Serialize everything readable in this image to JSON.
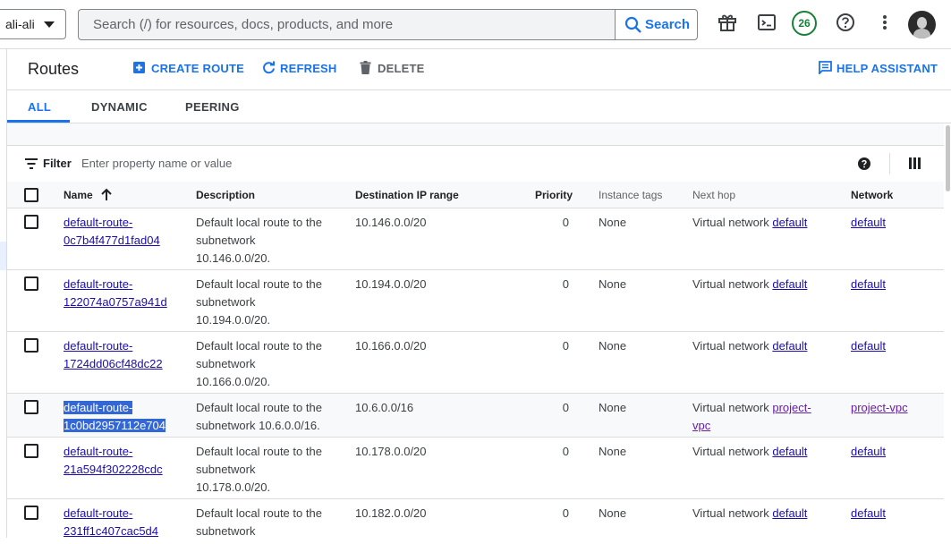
{
  "topbar": {
    "project": "ali-ali",
    "search_placeholder": "Search (/) for resources, docs, products, and more",
    "search_button": "Search",
    "notifications_count": "26"
  },
  "header": {
    "title": "Routes",
    "create": "CREATE ROUTE",
    "refresh": "REFRESH",
    "delete": "DELETE",
    "help": "HELP ASSISTANT"
  },
  "tabs": [
    "ALL",
    "DYNAMIC",
    "PEERING"
  ],
  "filter": {
    "label": "Filter",
    "placeholder": "Enter property name or value"
  },
  "columns": [
    "Name",
    "Description",
    "Destination IP range",
    "Priority",
    "Instance tags",
    "Next hop",
    "Network"
  ],
  "rows": [
    {
      "name1": "default-route-",
      "name2": "0c7b4f477d1fad04",
      "d1": "Default local route to the",
      "d2": "subnetwork",
      "d3": "10.146.0.0/20.",
      "ip": "10.146.0.0/20",
      "priority": "0",
      "tags": "None",
      "hop_text": "Virtual network",
      "hop_link1": "default",
      "hop_link2": "",
      "network": "default"
    },
    {
      "name1": "default-route-",
      "name2": "122074a0757a941d",
      "d1": "Default local route to the",
      "d2": "subnetwork",
      "d3": "10.194.0.0/20.",
      "ip": "10.194.0.0/20",
      "priority": "0",
      "tags": "None",
      "hop_text": "Virtual network",
      "hop_link1": "default",
      "hop_link2": "",
      "network": "default"
    },
    {
      "name1": "default-route-",
      "name2": "1724dd06cf48dc22",
      "d1": "Default local route to the",
      "d2": "subnetwork",
      "d3": "10.166.0.0/20.",
      "ip": "10.166.0.0/20",
      "priority": "0",
      "tags": "None",
      "hop_text": "Virtual network",
      "hop_link1": "default",
      "hop_link2": "",
      "network": "default"
    },
    {
      "name1": "default-route-",
      "name2": "1c0bd2957112e704",
      "d1": "Default local route to the",
      "d2": "subnetwork 10.6.0.0/16.",
      "d3": "",
      "ip": "10.6.0.0/16",
      "priority": "0",
      "tags": "None",
      "hop_text": "Virtual network",
      "hop_link1": "project-",
      "hop_link2": "vpc",
      "network": "project-vpc"
    },
    {
      "name1": "default-route-",
      "name2": "21a594f302228cdc",
      "d1": "Default local route to the",
      "d2": "subnetwork",
      "d3": "10.178.0.0/20.",
      "ip": "10.178.0.0/20",
      "priority": "0",
      "tags": "None",
      "hop_text": "Virtual network",
      "hop_link1": "default",
      "hop_link2": "",
      "network": "default"
    },
    {
      "name1": "default-route-",
      "name2": "231ff1c407cac5d4",
      "d1": "Default local route to the",
      "d2": "subnetwork",
      "d3": "",
      "ip": "10.182.0.0/20",
      "priority": "0",
      "tags": "None",
      "hop_text": "Virtual network",
      "hop_link1": "default",
      "hop_link2": "",
      "network": "default"
    }
  ]
}
